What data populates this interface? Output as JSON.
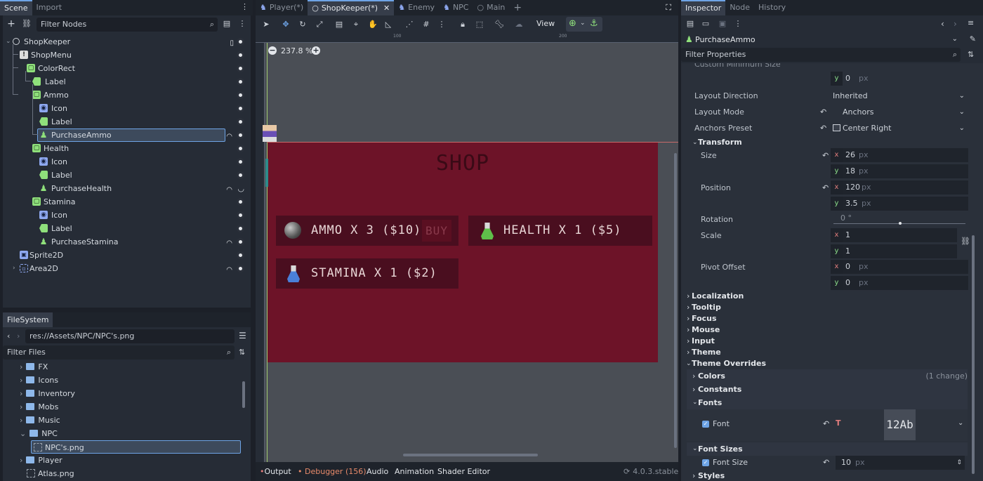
{
  "left_tabs": [
    "Scene",
    "Import"
  ],
  "scene_filter_placeholder": "Filter Nodes",
  "scene_tree": [
    {
      "label": "ShopKeeper",
      "indent": 0
    },
    {
      "label": "ShopMenu",
      "indent": 1
    },
    {
      "label": "ColorRect",
      "indent": 2
    },
    {
      "label": "Label",
      "indent": 3
    },
    {
      "label": "Ammo",
      "indent": 2
    },
    {
      "label": "Icon",
      "indent": 3
    },
    {
      "label": "Label",
      "indent": 3
    },
    {
      "label": "PurchaseAmmo",
      "indent": 3
    },
    {
      "label": "Health",
      "indent": 2
    },
    {
      "label": "Icon",
      "indent": 3
    },
    {
      "label": "Label",
      "indent": 3
    },
    {
      "label": "PurchaseHealth",
      "indent": 3
    },
    {
      "label": "Stamina",
      "indent": 2
    },
    {
      "label": "Icon",
      "indent": 3
    },
    {
      "label": "Label",
      "indent": 3
    },
    {
      "label": "PurchaseStamina",
      "indent": 3
    },
    {
      "label": "Sprite2D",
      "indent": 1
    },
    {
      "label": "Area2D",
      "indent": 1
    }
  ],
  "filesystem": {
    "tab": "FileSystem",
    "path": "res://Assets/NPC/NPC's.png",
    "filter_placeholder": "Filter Files",
    "items": [
      "FX",
      "Icons",
      "Inventory",
      "Mobs",
      "Music",
      "NPC",
      "NPC's.png",
      "Player",
      "Atlas.png"
    ]
  },
  "editor_tabs": [
    "Player(*)",
    "ShopKeeper(*)",
    "Enemy",
    "NPC",
    "Main"
  ],
  "toolbar": {
    "view": "View"
  },
  "zoom": "237.8 %",
  "shop": {
    "title": "SHOP",
    "ammo": "AMMO X 3 ($10)",
    "buy": "BUY",
    "health": "HEALTH X 1 ($5)",
    "stamina": "STAMINA X 1 ($2)"
  },
  "bottom_tabs": [
    "Output",
    "Debugger (156)",
    "Audio",
    "Animation",
    "Shader Editor"
  ],
  "version": "4.0.3.stable",
  "inspector": {
    "tabs": [
      "Inspector",
      "Node",
      "History"
    ],
    "node": "PurchaseAmmo",
    "filter_placeholder": "Filter Properties",
    "custom_min_size": "Custom Minimum Size",
    "cms_y": "0",
    "cms_unit": "px",
    "layout_direction": {
      "label": "Layout Direction",
      "value": "Inherited"
    },
    "layout_mode": {
      "label": "Layout Mode",
      "value": "Anchors"
    },
    "anchors_preset": {
      "label": "Anchors Preset",
      "value": "Center Right"
    },
    "transform": "Transform",
    "size": {
      "label": "Size",
      "x": "26",
      "y": "18"
    },
    "position": {
      "label": "Position",
      "x": "120",
      "y": "3.5"
    },
    "rotation": {
      "label": "Rotation",
      "value": "0 °"
    },
    "scale": {
      "label": "Scale",
      "x": "1",
      "y": "1"
    },
    "pivot": {
      "label": "Pivot Offset",
      "x": "0",
      "y": "0"
    },
    "unit": "px",
    "sections": [
      "Localization",
      "Tooltip",
      "Focus",
      "Mouse",
      "Input",
      "Theme"
    ],
    "theme_overrides": "Theme Overrides",
    "colors": "Colors",
    "colors_note": "(1 change)",
    "constants": "Constants",
    "fonts": "Fonts",
    "font": "Font",
    "font_preview": "12Ab",
    "font_sizes": "Font Sizes",
    "font_size": {
      "label": "Font Size",
      "value": "10"
    },
    "styles": "Styles"
  }
}
